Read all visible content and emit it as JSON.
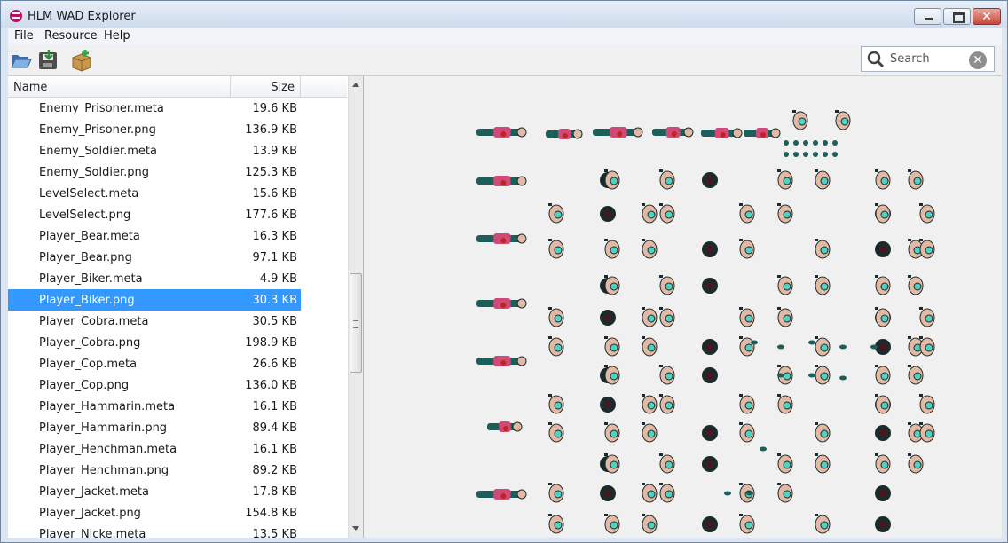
{
  "window": {
    "title": "HLM WAD Explorer",
    "close_glyph": "✕"
  },
  "menu": [
    "File",
    "Resource",
    "Help"
  ],
  "toolbar": {
    "buttons": [
      {
        "icon": "folder-open-icon"
      },
      {
        "icon": "save-export-icon"
      },
      {
        "icon": "package-add-icon"
      }
    ],
    "search": {
      "placeholder": "Search",
      "value": "",
      "clear_glyph": "✕"
    }
  },
  "file_list": {
    "columns": {
      "name": "Name",
      "size": "Size"
    },
    "rows": [
      {
        "name": "Enemy_Prisoner.meta",
        "size": "19.6 KB"
      },
      {
        "name": "Enemy_Prisoner.png",
        "size": "136.9 KB"
      },
      {
        "name": "Enemy_Soldier.meta",
        "size": "13.9 KB"
      },
      {
        "name": "Enemy_Soldier.png",
        "size": "125.3 KB"
      },
      {
        "name": "LevelSelect.meta",
        "size": "15.6 KB"
      },
      {
        "name": "LevelSelect.png",
        "size": "177.6 KB"
      },
      {
        "name": "Player_Bear.meta",
        "size": "16.3 KB"
      },
      {
        "name": "Player_Bear.png",
        "size": "97.1 KB"
      },
      {
        "name": "Player_Biker.meta",
        "size": "4.9 KB"
      },
      {
        "name": "Player_Biker.png",
        "size": "30.3 KB",
        "selected": true
      },
      {
        "name": "Player_Cobra.meta",
        "size": "30.5 KB"
      },
      {
        "name": "Player_Cobra.png",
        "size": "198.9 KB"
      },
      {
        "name": "Player_Cop.meta",
        "size": "26.6 KB"
      },
      {
        "name": "Player_Cop.png",
        "size": "136.0 KB"
      },
      {
        "name": "Player_Hammarin.meta",
        "size": "16.1 KB"
      },
      {
        "name": "Player_Hammarin.png",
        "size": "89.4 KB"
      },
      {
        "name": "Player_Henchman.meta",
        "size": "16.1 KB"
      },
      {
        "name": "Player_Henchman.png",
        "size": "89.2 KB"
      },
      {
        "name": "Player_Jacket.meta",
        "size": "17.8 KB"
      },
      {
        "name": "Player_Jacket.png",
        "size": "154.8 KB"
      },
      {
        "name": "Player_Nicke.meta",
        "size": "13.5 KB"
      }
    ]
  },
  "preview": {
    "colors": {
      "skin": "#e2b9a5",
      "pink": "#d04a78",
      "teal": "#1c5e5a",
      "dark": "#1b2a2b",
      "blood": "#c0241c",
      "cyan": "#4fd2c4",
      "maroon": "#4a1620"
    }
  }
}
